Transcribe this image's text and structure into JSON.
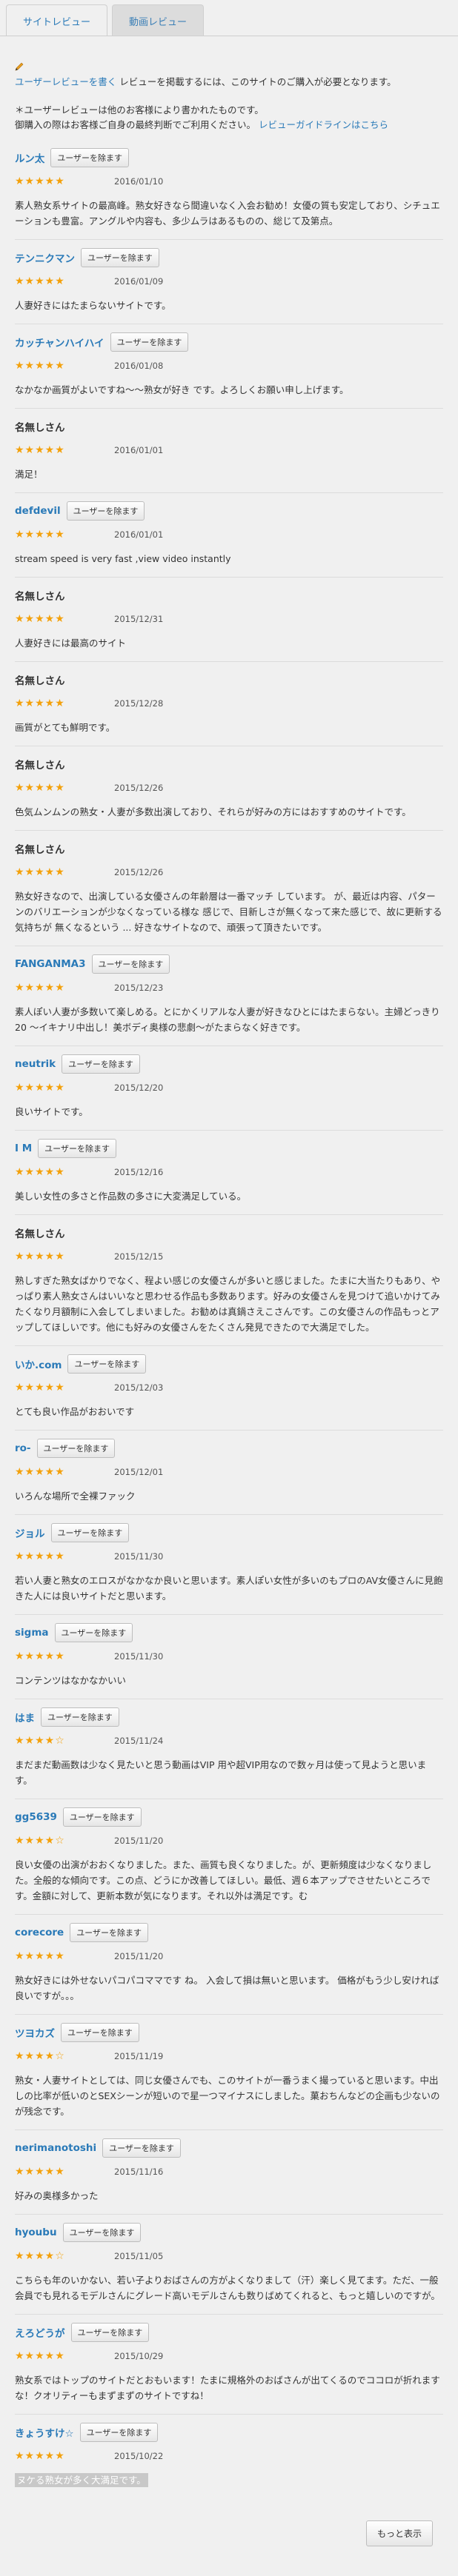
{
  "tabs": [
    "サイトレビュー",
    "動画レビュー"
  ],
  "notice": {
    "link": "ユーザーレビューを書く",
    "text": "レビューを掲載するには、このサイトのご購入が必要となります。"
  },
  "note2": {
    "line1": "＊ユーザーレビューは他のお客様により書かれたものです。",
    "line2": "御購入の際はお客様ご自身の最終判断でご利用ください。",
    "link": "レビューガイドラインはこちら"
  },
  "follow_label": "ユーザーを除ます",
  "reviews": [
    {
      "user": "ルン太",
      "btn": true,
      "stars": "★★★★★",
      "date": "2016/01/10",
      "text": "素人熟女系サイトの最高峰。熟女好きなら間違いなく入会お勧め！女優の質も安定しており、シチュエーションも豊富。アングルや内容も、多少ムラはあるものの、総じて及第点。"
    },
    {
      "user": "テンニクマン",
      "btn": true,
      "stars": "★★★★★",
      "date": "2016/01/09",
      "text": "人妻好きにはたまらないサイトです。"
    },
    {
      "user": "カッチャンハイハイ",
      "btn": true,
      "stars": "★★★★★",
      "date": "2016/01/08",
      "text": "なかなか画質がよいですね〜〜熟女が好き です。よろしくお願い申し上げます。"
    },
    {
      "user": "名無しさん",
      "btn": false,
      "stars": "★★★★★",
      "date": "2016/01/01",
      "text": "満足！"
    },
    {
      "user": "defdevil",
      "btn": true,
      "stars": "★★★★★",
      "date": "2016/01/01",
      "text": "stream speed is very fast ,view video instantly"
    },
    {
      "user": "名無しさん",
      "btn": false,
      "stars": "★★★★★",
      "date": "2015/12/31",
      "text": "人妻好きには最高のサイト"
    },
    {
      "user": "名無しさん",
      "btn": false,
      "stars": "★★★★★",
      "date": "2015/12/28",
      "text": "画質がとても鮮明です。"
    },
    {
      "user": "名無しさん",
      "btn": false,
      "stars": "★★★★★",
      "date": "2015/12/26",
      "text": "色気ムンムンの熟女・人妻が多数出演しており、それらが好みの方にはおすすめのサイトです。"
    },
    {
      "user": "名無しさん",
      "btn": false,
      "stars": "★★★★★",
      "date": "2015/12/26",
      "text": "熟女好きなので、出演している女優さんの年齢層は一番マッチ しています。 が、最近は内容、パターンのバリエーションが少なくなっている様な 感じで、目新しさが無くなって来た感じで、故に更新する気持ちが 無くなるという ... 好きなサイトなので、頑張って頂きたいです。"
    },
    {
      "user": "FANGANMA3",
      "btn": true,
      "stars": "★★★★★",
      "date": "2015/12/23",
      "text": "素人ぽい人妻が多数いて楽しめる。とにかくリアルな人妻が好きなひとにはたまらない。主婦どっきり20 〜イキナリ中出し！美ボディ奥様の悲劇〜がたまらなく好きです。"
    },
    {
      "user": "neutrik",
      "btn": true,
      "stars": "★★★★★",
      "date": "2015/12/20",
      "text": "良いサイトです。"
    },
    {
      "user": "I M",
      "btn": true,
      "stars": "★★★★★",
      "date": "2015/12/16",
      "text": "美しい女性の多さと作品数の多さに大変満足している。"
    },
    {
      "user": "名無しさん",
      "btn": false,
      "stars": "★★★★★",
      "date": "2015/12/15",
      "text": "熟しすぎた熟女ばかりでなく、程よい感じの女優さんが多いと感じました。たまに大当たりもあり、やっぱり素人熟女さんはいいなと思わせる作品も多数あります。好みの女優さんを見つけて追いかけてみたくなり月額制に入会してしまいました。お勧めは真鍋さえこさんです。この女優さんの作品もっとアップしてほしいです。他にも好みの女優さんをたくさん発見できたので大満足でした。"
    },
    {
      "user": "いか.com",
      "btn": true,
      "stars": "★★★★★",
      "date": "2015/12/03",
      "text": "とても良い作品がおおいです"
    },
    {
      "user": "ro-",
      "btn": true,
      "stars": "★★★★★",
      "date": "2015/12/01",
      "text": "いろんな場所で全裸ファック"
    },
    {
      "user": "ジョル",
      "btn": true,
      "stars": "★★★★★",
      "date": "2015/11/30",
      "text": "若い人妻と熟女のエロスがなかなか良いと思います。素人ぽい女性が多いのもプロのAV女優さんに見飽きた人には良いサイトだと思います。"
    },
    {
      "user": "sigma",
      "btn": true,
      "stars": "★★★★★",
      "date": "2015/11/30",
      "text": "コンテンツはなかなかいい"
    },
    {
      "user": "はま",
      "btn": true,
      "stars": "★★★★☆",
      "date": "2015/11/24",
      "text": "まだまだ動画数は少なく見たいと思う動画はVIP 用や超VIP用なので数ヶ月は使って見ようと思います。"
    },
    {
      "user": "gg5639",
      "btn": true,
      "stars": "★★★★☆",
      "date": "2015/11/20",
      "text": "良い女優の出演がおおくなりました。また、画質も良くなりました。が、更新頻度は少なくなりました。全般的な傾向です。この点、どうにか改善してほしい。最低、週６本アップでさせたいところです。金額に対して、更新本数が気になります。それ以外は満足です。む"
    },
    {
      "user": "corecore",
      "btn": true,
      "stars": "★★★★★",
      "date": "2015/11/20",
      "text": "熟女好きには外せないパコパコママです ね。 入会して損は無いと思います。 価格がもう少し安ければ良いですが。。。"
    },
    {
      "user": "ツヨカズ",
      "btn": true,
      "stars": "★★★★☆",
      "date": "2015/11/19",
      "text": "熟女・人妻サイトとしては、同じ女優さんでも、このサイトが一番うまく撮っていると思います。中出しの比率が低いのとSEXシーンが短いので星一つマイナスにしました。菓おちんなどの企画も少ないのが残念です。"
    },
    {
      "user": "nerimanotoshi",
      "btn": true,
      "stars": "★★★★★",
      "date": "2015/11/16",
      "text": "好みの奥様多かった"
    },
    {
      "user": "hyoubu",
      "btn": true,
      "stars": "★★★★☆",
      "date": "2015/11/05",
      "text": "こちらも年のいかない、若い子よりおばさんの方がよくなりまして（汗）楽しく見てます。ただ、一般会員でも見れるモデルさんにグレード高いモデルさんも数りばめてくれると、もっと嬉しいのですが。"
    },
    {
      "user": "えろどうが",
      "btn": true,
      "stars": "★★★★★",
      "date": "2015/10/29",
      "text": "熟女系ではトップのサイトだとおもいます！たまに規格外のおばさんが出てくるのでココロが折れますな！クオリティーもまずまずのサイトですね！"
    },
    {
      "user": "きょうすけ☆",
      "btn": true,
      "stars": "★★★★★",
      "date": "2015/10/22",
      "text": "ヌケる熟女が多く大満足です。",
      "highlight": true
    }
  ],
  "more_label": "もっと表示"
}
